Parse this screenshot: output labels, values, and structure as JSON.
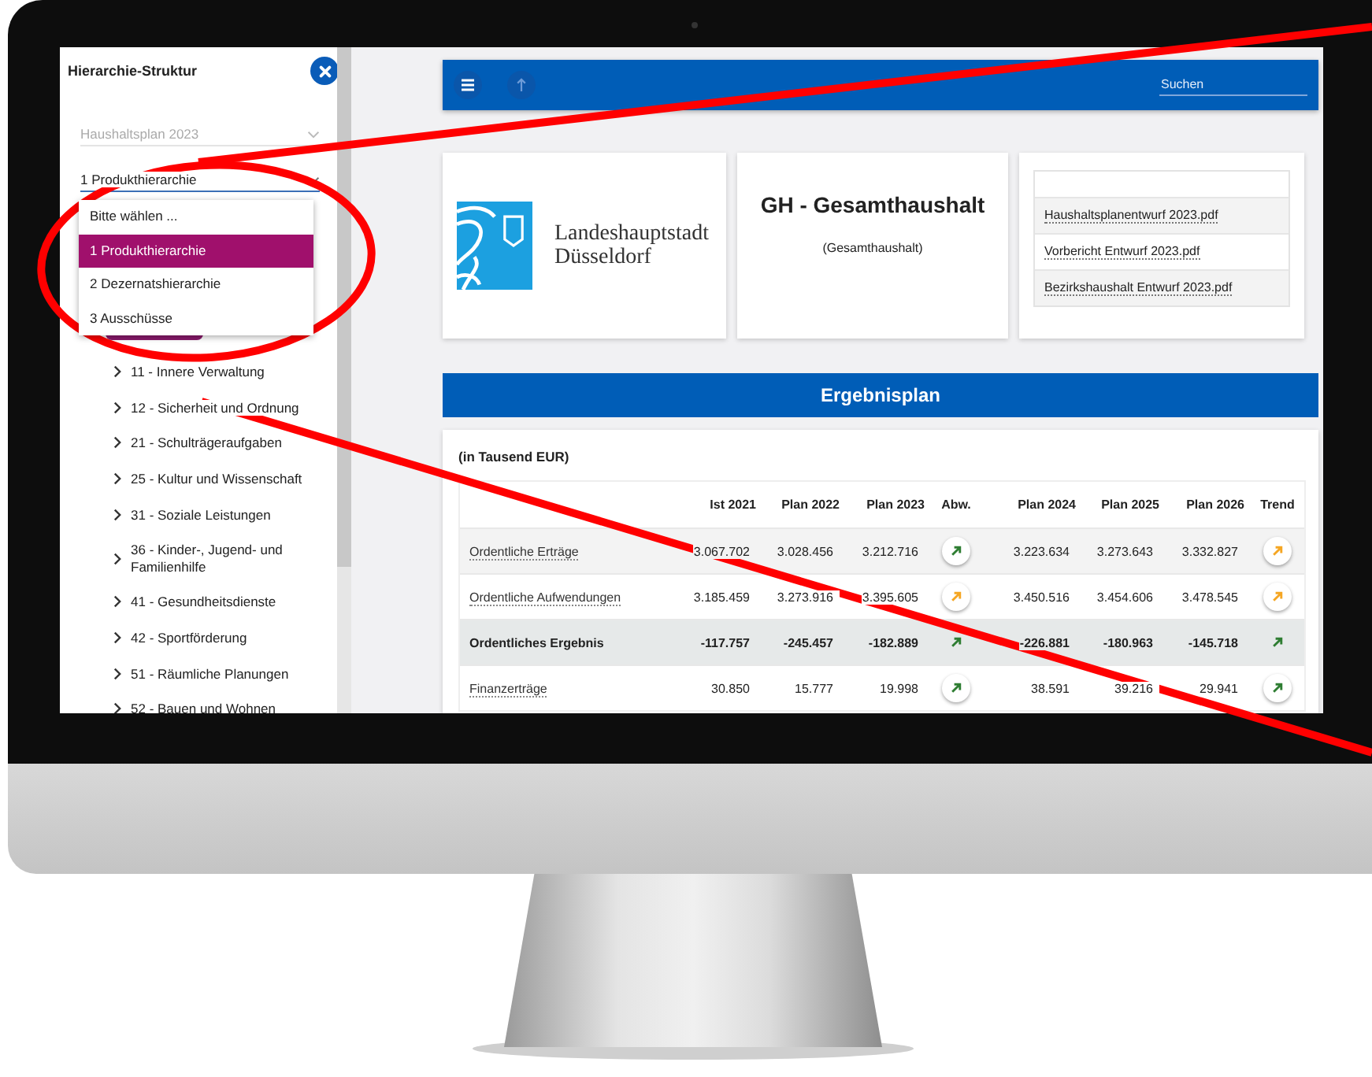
{
  "sidebar": {
    "title": "Hierarchie-Struktur",
    "plan_select": {
      "value": "Haushaltsplan 2023"
    },
    "hierarchy_select": {
      "value": "1 Produkthierarchie",
      "open": true,
      "options": [
        {
          "label": "Bitte wählen ...",
          "selected": false
        },
        {
          "label": "1 Produkthierarchie",
          "selected": true
        },
        {
          "label": "2 Dezernatshierarchie",
          "selected": false
        },
        {
          "label": "3 Ausschüsse",
          "selected": false
        }
      ]
    },
    "tree": [
      {
        "label": "11 - Innere Verwaltung",
        "expanded": false
      },
      {
        "label": "12 - Sicherheit und Ordnung",
        "expanded": false
      },
      {
        "label": "21 - Schulträgeraufgaben",
        "expanded": false
      },
      {
        "label": "25 - Kultur und Wissenschaft",
        "expanded": false
      },
      {
        "label": "31 - Soziale Leistungen",
        "expanded": false
      },
      {
        "label": "36 - Kinder-, Jugend- und Familienhilfe",
        "expanded": false
      },
      {
        "label": "41 - Gesundheitsdienste",
        "expanded": false
      },
      {
        "label": "42 - Sportförderung",
        "expanded": false
      },
      {
        "label": "51 - Räumliche Planungen",
        "expanded": false
      },
      {
        "label": "52 - Bauen und Wohnen",
        "expanded": false
      }
    ]
  },
  "toolbar": {
    "search": {
      "placeholder": "Suchen"
    }
  },
  "logo": {
    "text": "Landeshauptstadt Düsseldorf"
  },
  "title_card": {
    "title": "GH - Gesamthaushalt",
    "subtitle": "(Gesamthaushalt)"
  },
  "documents": [
    "Haushaltsplanentwurf 2023.pdf",
    "Vorbericht Entwurf 2023.pdf",
    "Bezirkshaushalt Entwurf 2023.pdf"
  ],
  "section_title": "Ergebnisplan",
  "table": {
    "caption": "(in Tausend EUR)",
    "columns": [
      "Ist 2021",
      "Plan 2022",
      "Plan 2023",
      "Abw.",
      "Plan 2024",
      "Plan 2025",
      "Plan 2026",
      "Trend"
    ],
    "rows": [
      {
        "kind": "item",
        "label": "Ordentliche Erträge",
        "values": [
          "3.067.702",
          "3.028.456",
          "3.212.716"
        ],
        "abw": {
          "color": "#2e7d32"
        },
        "plan": [
          "3.223.634",
          "3.273.643",
          "3.332.827"
        ],
        "trend": {
          "color": "#f5a623"
        }
      },
      {
        "kind": "item",
        "label": "Ordentliche Aufwendungen",
        "values": [
          "3.185.459",
          "3.273.916",
          "3.395.605"
        ],
        "abw": {
          "color": "#f5a623"
        },
        "plan": [
          "3.450.516",
          "3.454.606",
          "3.478.545"
        ],
        "trend": {
          "color": "#f5a623"
        }
      },
      {
        "kind": "total",
        "label": "Ordentliches Ergebnis",
        "values": [
          "-117.757",
          "-245.457",
          "-182.889"
        ],
        "abw": {
          "color": "#2e7d32"
        },
        "plan": [
          "-226.881",
          "-180.963",
          "-145.718"
        ],
        "trend": {
          "color": "#2e7d32"
        }
      },
      {
        "kind": "item",
        "label": "Finanzerträge",
        "values": [
          "30.850",
          "15.777",
          "19.998"
        ],
        "abw": {
          "color": "#2e7d32"
        },
        "plan": [
          "38.591",
          "39.216",
          "29.941"
        ],
        "trend": {
          "color": "#2e7d32"
        }
      }
    ]
  }
}
